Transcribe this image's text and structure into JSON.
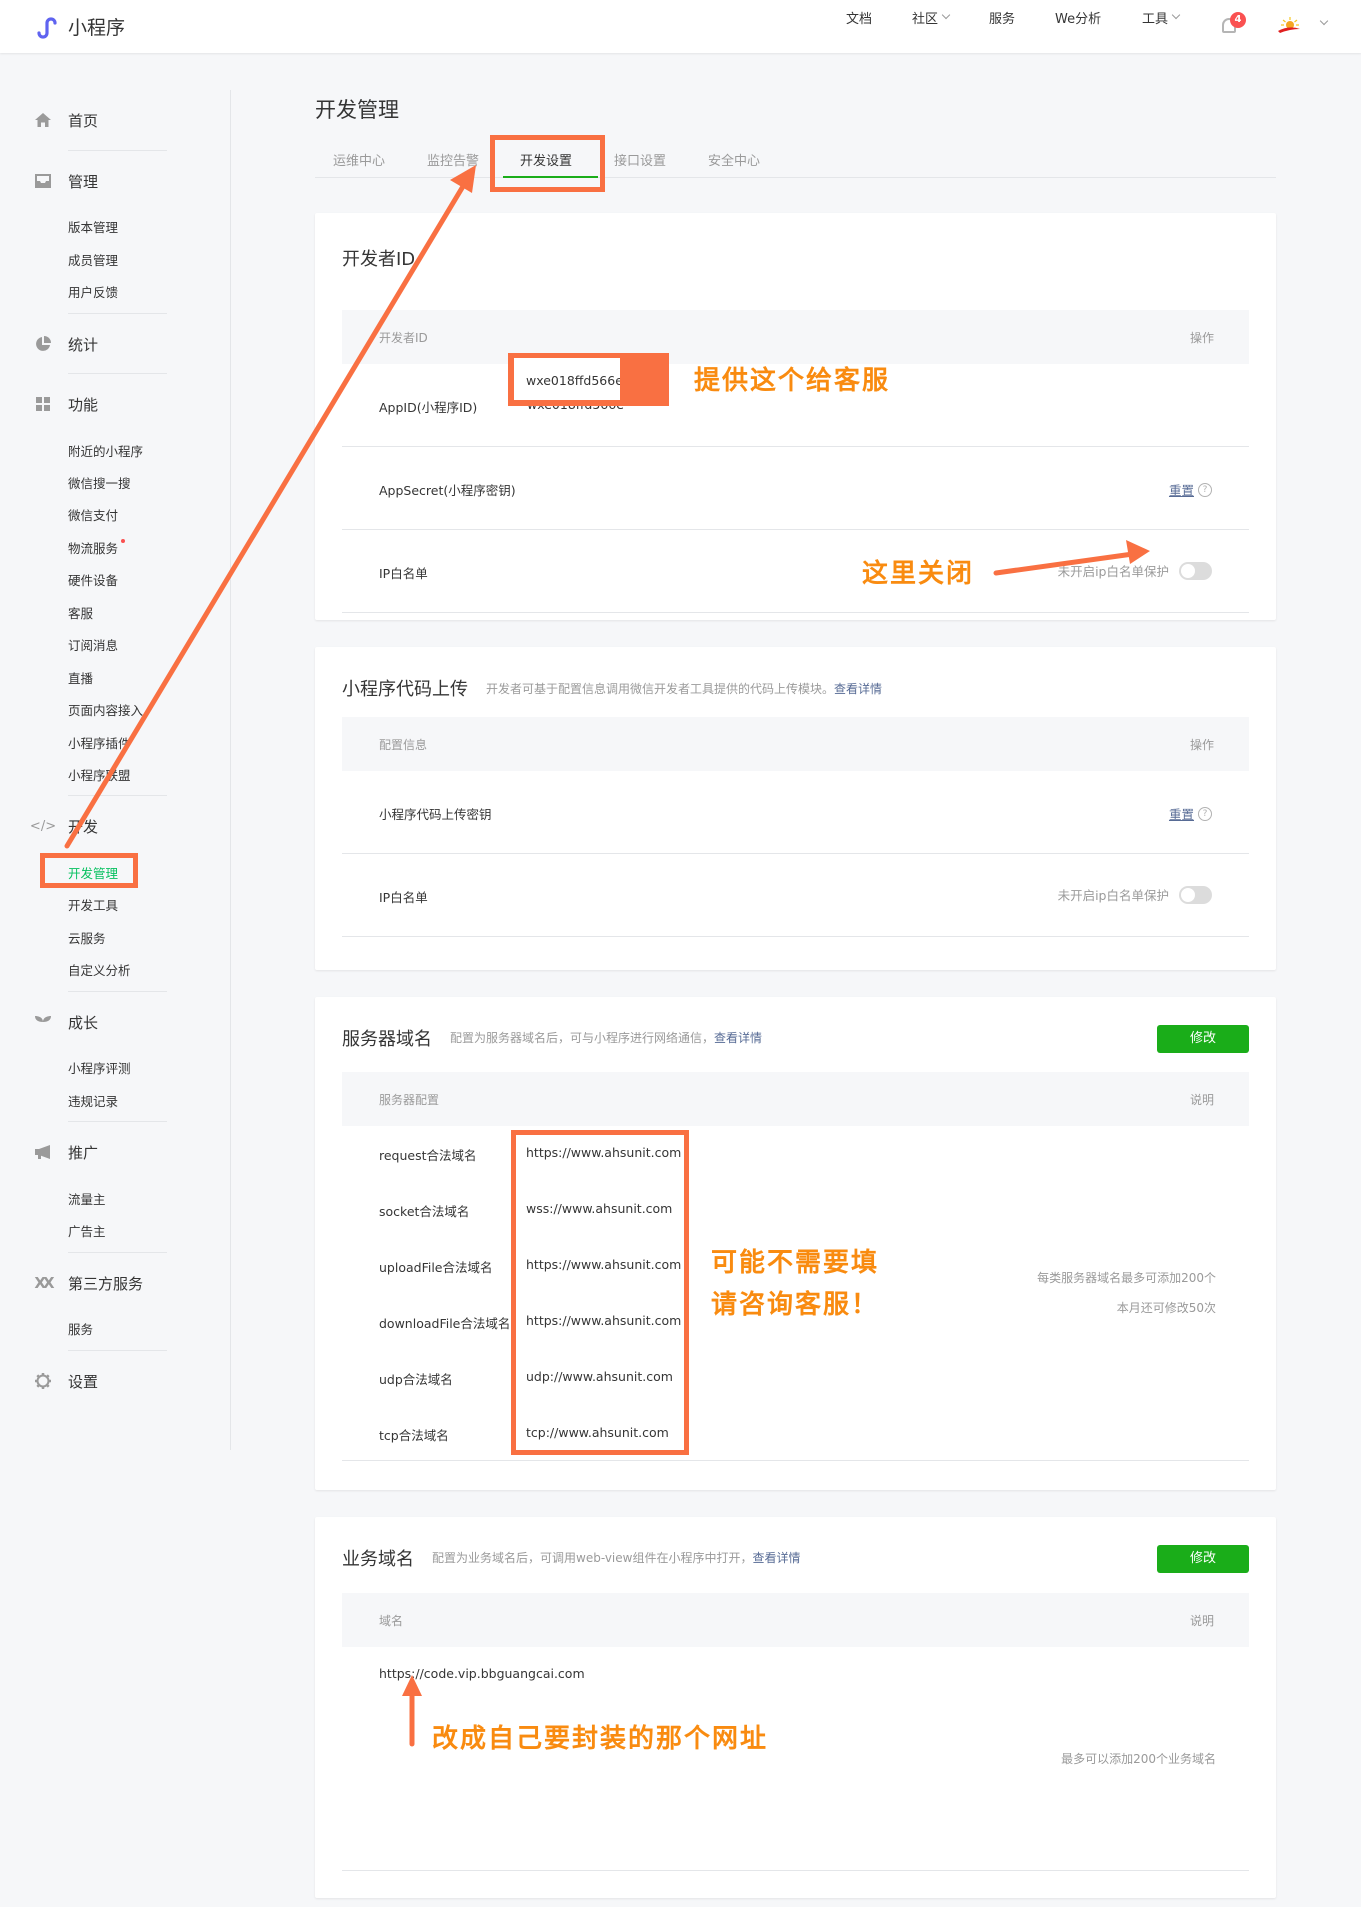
{
  "header": {
    "app_title": "小程序",
    "nav": [
      {
        "label": "文档",
        "dropdown": false
      },
      {
        "label": "社区",
        "dropdown": true
      },
      {
        "label": "服务",
        "dropdown": false
      },
      {
        "label": "We分析",
        "dropdown": false
      },
      {
        "label": "工具",
        "dropdown": true
      }
    ],
    "notification_count": "4",
    "colors": {
      "logo": "#5f63f0",
      "badge": "#fa5151"
    }
  },
  "sidebar": {
    "groups": [
      {
        "label": "首页",
        "icon": "home-icon",
        "items": []
      },
      {
        "label": "管理",
        "icon": "inbox-icon",
        "items": [
          "版本管理",
          "成员管理",
          "用户反馈"
        ]
      },
      {
        "label": "统计",
        "icon": "pie-chart-icon",
        "items": []
      },
      {
        "label": "功能",
        "icon": "grid-icon",
        "items": [
          "附近的小程序",
          "微信搜一搜",
          "微信支付",
          "物流服务",
          "硬件设备",
          "客服",
          "订阅消息",
          "直播",
          "页面内容接入",
          "小程序插件",
          "小程序联盟"
        ]
      },
      {
        "label": "开发",
        "icon": "code-icon",
        "items": [
          "开发管理",
          "开发工具",
          "云服务",
          "自定义分析"
        ]
      },
      {
        "label": "成长",
        "icon": "sprout-icon",
        "items": [
          "小程序评测",
          "违规记录"
        ]
      },
      {
        "label": "推广",
        "icon": "megaphone-icon",
        "items": [
          "流量主",
          "广告主"
        ]
      },
      {
        "label": "第三方服务",
        "icon": "third-party-icon",
        "items": [
          "服务"
        ]
      },
      {
        "label": "设置",
        "icon": "gear-icon",
        "items": []
      }
    ],
    "active_item": "开发管理",
    "accent": "#07c160"
  },
  "main": {
    "page_title": "开发管理",
    "tabs": [
      {
        "label": "运维中心",
        "active": false
      },
      {
        "label": "监控告警",
        "active": false
      },
      {
        "label": "开发设置",
        "active": true
      },
      {
        "label": "接口设置",
        "active": false
      },
      {
        "label": "安全中心",
        "active": false
      }
    ],
    "developer_id": {
      "title": "开发者ID",
      "col_left": "开发者ID",
      "col_right": "操作",
      "rows": {
        "appid_label": "AppID(小程序ID)",
        "appid_value": "wxe018ffd566e",
        "secret_label": "AppSecret(小程序密钥)",
        "secret_action": "重置",
        "ip_label": "IP白名单",
        "ip_status": "未开启ip白名单保护"
      }
    },
    "code_upload": {
      "title": "小程序代码上传",
      "desc": "开发者可基于配置信息调用微信开发者工具提供的代码上传模块。",
      "desc_link": "查看详情",
      "col_left": "配置信息",
      "col_right": "操作",
      "key_label": "小程序代码上传密钥",
      "key_action": "重置",
      "ip_label": "IP白名单",
      "ip_status": "未开启ip白名单保护"
    },
    "server_domain": {
      "title": "服务器域名",
      "desc": "配置为服务器域名后，可与小程序进行网络通信，",
      "desc_link": "查看详情",
      "edit_button": "修改",
      "col_left": "服务器配置",
      "col_right": "说明",
      "rows": [
        {
          "label": "request合法域名",
          "value": "https://www.ahsunit.com"
        },
        {
          "label": "socket合法域名",
          "value": "wss://www.ahsunit.com"
        },
        {
          "label": "uploadFile合法域名",
          "value": "https://www.ahsunit.com"
        },
        {
          "label": "downloadFile合法域名",
          "value": "https://www.ahsunit.com"
        },
        {
          "label": "udp合法域名",
          "value": "udp://www.ahsunit.com"
        },
        {
          "label": "tcp合法域名",
          "value": "tcp://www.ahsunit.com"
        }
      ],
      "note_line1": "每类服务器域名最多可添加200个",
      "note_line2": "本月还可修改50次"
    },
    "business_domain": {
      "title": "业务域名",
      "desc": "配置为业务域名后，可调用web-view组件在小程序中打开，",
      "desc_link": "查看详情",
      "edit_button": "修改",
      "col_left": "域名",
      "col_right": "说明",
      "domain": "https://code.vip.bbguangcai.com",
      "note": "最多可以添加200个业务域名"
    }
  },
  "annotations": {
    "appid_hint": "提供这个给客服",
    "ip_hint": "这里关闭",
    "server_hint_line1": "可能不需要填",
    "server_hint_line2": "请咨询客服！",
    "business_hint": "改成自己要封装的那个网址",
    "color": "#f97042",
    "text_color": "#f98b10"
  }
}
